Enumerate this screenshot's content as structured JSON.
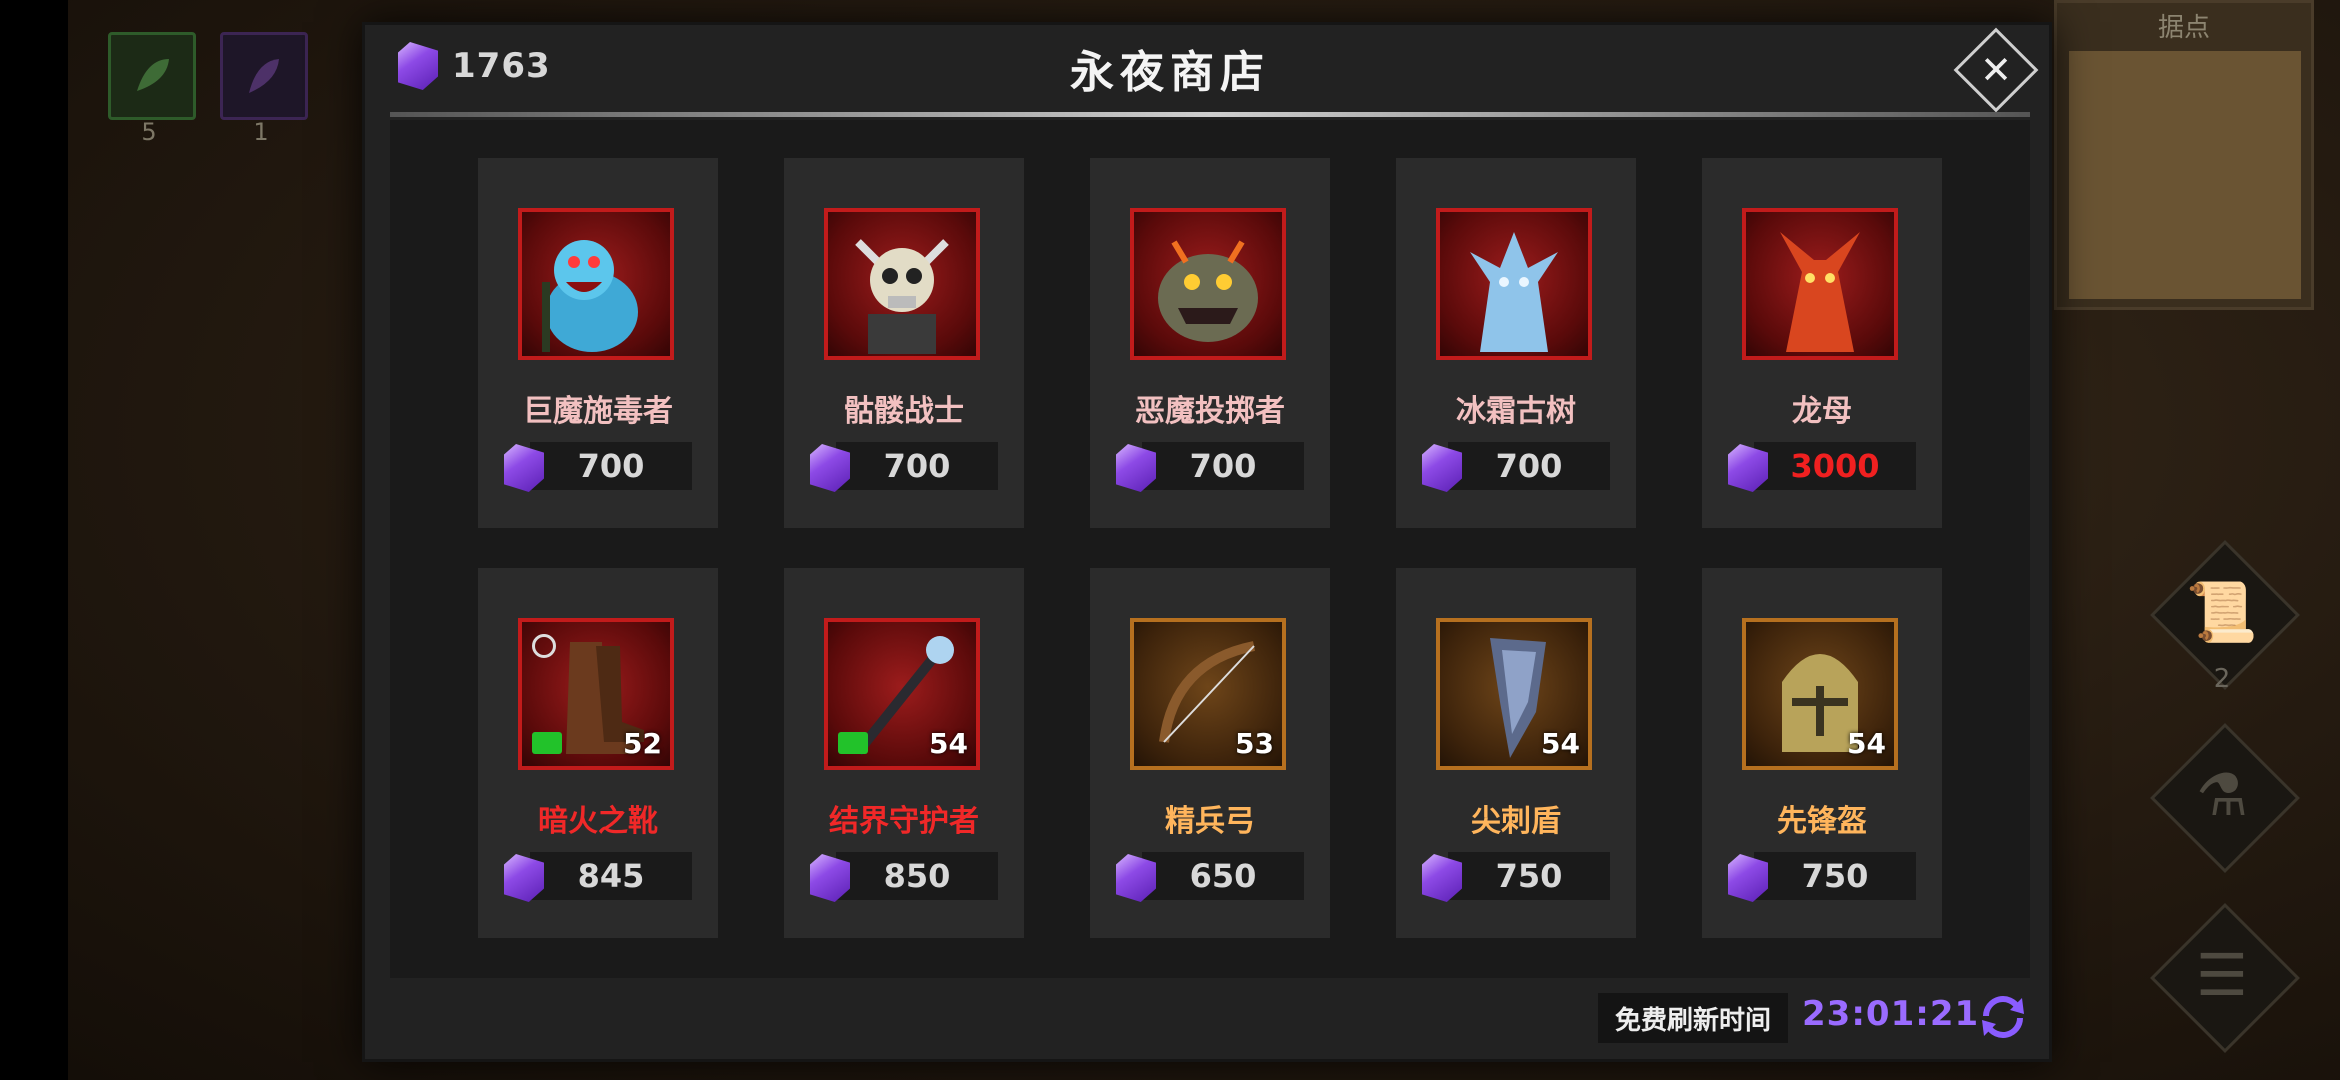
{
  "hud": {
    "slot_green_count": "5",
    "slot_purple_count": "1"
  },
  "minimap": {
    "title": "据点"
  },
  "side_menu": {
    "scroll_count": "2"
  },
  "shop": {
    "title": "永夜商店",
    "currency_amount": "1763",
    "refresh_label": "免费刷新时间",
    "refresh_timer": "23:01:21",
    "items": [
      {
        "name": "巨魔施毒者",
        "price": "700"
      },
      {
        "name": "骷髅战士",
        "price": "700"
      },
      {
        "name": "恶魔投掷者",
        "price": "700"
      },
      {
        "name": "冰霜古树",
        "price": "700"
      },
      {
        "name": "龙母",
        "price": "3000"
      },
      {
        "name": "暗火之靴",
        "price": "845",
        "level": "52"
      },
      {
        "name": "结界守护者",
        "price": "850",
        "level": "54"
      },
      {
        "name": "精兵弓",
        "price": "650",
        "level": "53"
      },
      {
        "name": "尖刺盾",
        "price": "750",
        "level": "54"
      },
      {
        "name": "先锋盔",
        "price": "750",
        "level": "54"
      }
    ]
  },
  "colors": {
    "accent_purple": "#9a6bff",
    "price_unaffordable": "#f02020",
    "rarity_red": "#c21b1b",
    "rarity_orange": "#b6701f"
  }
}
